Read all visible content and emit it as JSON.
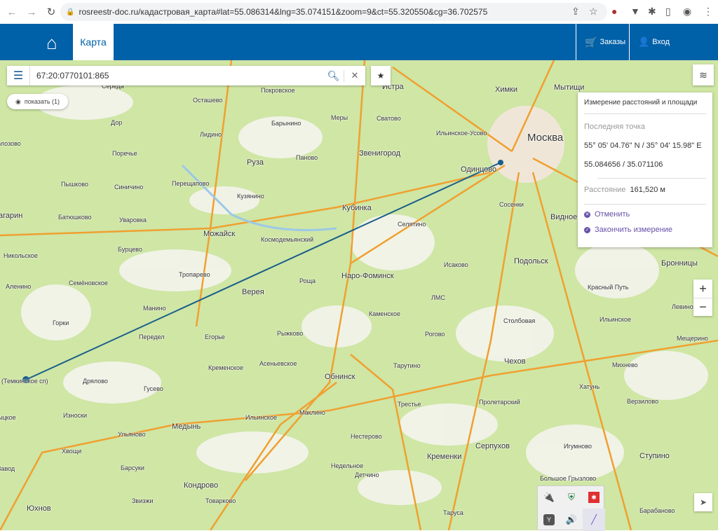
{
  "browser": {
    "url": "rosreestr-doc.ru/кадастровая_карта#lat=55.086314&lng=35.074151&zoom=9&ct=55.320550&cg=36.702575"
  },
  "header": {
    "tab": "Карта",
    "orders": "Заказы",
    "login": "Вход"
  },
  "search": {
    "value": "67:20:0770101:865",
    "show_label": "показать (1)"
  },
  "measure": {
    "title": "Измерение расстояний и площади",
    "last_point_label": "Последняя точка",
    "dms": "55° 05' 04.76\" N / 35° 04' 15.98\" E",
    "decimal": "55.084656 / 35.071106",
    "distance_label": "Расстояние",
    "distance_value": "161,520 м",
    "cancel": "Отменить",
    "finish": "Закончить измерение"
  },
  "zoom": {
    "in": "+",
    "out": "−"
  },
  "route_color": "#1a5e8a",
  "header_color": "#0060a8",
  "map_labels": [
    "Середа",
    "Покровское",
    "Истра",
    "Химки",
    "Мытищи",
    "Осташево",
    "Барынино",
    "Меры",
    "Сватово",
    "Москва",
    "Ильинское-Усово",
    "Дор",
    "Лидино",
    "Звенигород",
    "олозово",
    "Поречье",
    "Руза",
    "Паново",
    "Одинцово",
    "Пышково",
    "Синичино",
    "Перещапово",
    "Кузянино",
    "Кубинка",
    "Сосенки",
    "агарин",
    "Батюшково",
    "Уваровка",
    "Можайск",
    "Космодемьянский",
    "Селятино",
    "Видное",
    "Никольское",
    "Бурцево",
    "Исаково",
    "Подольск",
    "Бронницы",
    "Тропарево",
    "Наро-Фоминск",
    "Аленино",
    "Семёновское",
    "Верея",
    "Роща",
    "Красный Путь",
    "Манино",
    "ЛМС",
    "Каменское",
    "Столбовая",
    "Левино",
    "Горки",
    "Ильинское",
    "Передел",
    "Егорье",
    "Рыжково",
    "Рогово",
    "Мещерино",
    "(Темкинское сп)",
    "Дрялово",
    "Кременское",
    "Асеньевское",
    "Тарутино",
    "Чехов",
    "Михнево",
    "Обнинск",
    "Гусево",
    "Хатунь",
    "Трестье",
    "Пролетарский",
    "Верзилово",
    "ыцкое",
    "Износки",
    "Ильинское",
    "Маклино",
    "Медынь",
    "Ульяново",
    "Нестерово",
    "Серпухов",
    "Игумново",
    "Ступино",
    "Хвощи",
    "Барсуки",
    "Недельное",
    "Кременки",
    "Завод",
    "Кондрово",
    "Детчино",
    "Большое Грызлово",
    "Звизжи",
    "Товарково",
    "Таруса",
    "Барабаново",
    "Юхнов"
  ]
}
